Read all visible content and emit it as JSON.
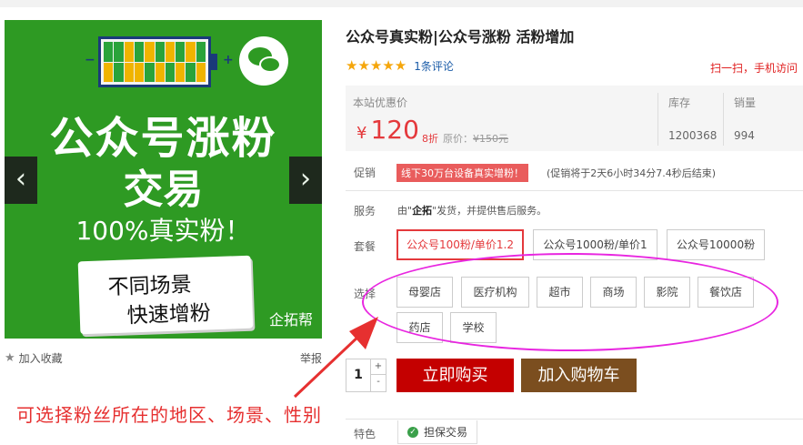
{
  "gallery": {
    "hero_line1": "公众号涨粉",
    "hero_line2": "交易",
    "hero_line3": "100%真实粉！",
    "scroll_line1": "不同场景",
    "scroll_line2": "快速增粉",
    "brand": "企拓帮",
    "prev_icon": "‹",
    "next_icon": "›",
    "battery_minus": "−",
    "battery_plus": "+"
  },
  "actions": {
    "favorite_label": "加入收藏",
    "report_label": "举报"
  },
  "product": {
    "title": "公众号真实粉|公众号涨粉 活粉增加",
    "stars": "★★★★★",
    "rating_score": 5,
    "review_link": "1条评论",
    "scan_text": "扫一扫，手机访问"
  },
  "price": {
    "label": "本站优惠价",
    "currency": "¥",
    "value": "120",
    "discount": "8折",
    "original_label": "原价：",
    "original_price": "¥150元",
    "stock_label": "库存",
    "stock_value": "1200368",
    "sales_label": "销量",
    "sales_value": "994"
  },
  "promotion": {
    "label": "促销",
    "tag": "线下30万台设备真实增粉！",
    "countdown": "(促销将于2天6小时34分7.4秒后结束)"
  },
  "service": {
    "label": "服务",
    "prefix": "由\"",
    "seller": "企拓",
    "suffix": "\"发货，并提供售后服务。"
  },
  "package": {
    "label": "套餐",
    "options": [
      "公众号100粉/单价1.2",
      "公众号1000粉/单价1",
      "公众号10000粉"
    ],
    "selected_index": 0
  },
  "location": {
    "label": "选择",
    "options": [
      "母婴店",
      "医疗机构",
      "超市",
      "商场",
      "影院",
      "餐饮店",
      "药店",
      "学校"
    ]
  },
  "purchase": {
    "quantity": "1",
    "increase_icon": "+",
    "decrease_icon": "-",
    "buy_now": "立即购买",
    "add_to_cart": "加入购物车"
  },
  "annotation": {
    "text": "可选择粉丝所在的地区、场景、性别",
    "color": "#e63030",
    "ellipse_color": "#e826e0"
  },
  "features": {
    "label": "特色",
    "guarantee": "担保交易"
  },
  "colors": {
    "hero_bg": "#2e9a23",
    "price_red": "#e4393c",
    "buy_btn": "#c40000",
    "cart_btn": "#7b4e1f",
    "star": "#f5a60b"
  }
}
